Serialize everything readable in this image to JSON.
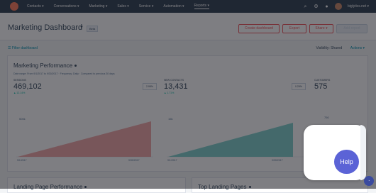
{
  "nav": {
    "items": [
      "Contacts ▾",
      "Conversations ▾",
      "Marketing ▾",
      "Sales ▾",
      "Service ▾",
      "Automation ▾",
      "Reports ▾"
    ],
    "account": "biglytics.net ▾"
  },
  "header": {
    "title": "Marketing Dashboard",
    "beta": "Beta",
    "create_button": "Create dashboard",
    "export_button": "Export",
    "share_button": "Share ▾",
    "add_report_button": "Add report"
  },
  "filters": {
    "left": "☰  Filter dashboard",
    "visibility": "Visibility:  Shared",
    "actions": "Actions ▾"
  },
  "performance": {
    "title": "Marketing Performance",
    "meta": "Date range: From 9/1/2017 to 9/30/2017  ·  Frequency: Daily  ·  Compared to previous 30 days",
    "kpis": [
      {
        "label": "SESSIONS",
        "value": "469,102",
        "delta": "▲ 12.14%",
        "pill": "2.95%"
      },
      {
        "label": "NEW CONTACTS",
        "value": "13,431",
        "delta": "▲ 1.71%",
        "pill": "0.29%"
      },
      {
        "label": "CUSTOMERS",
        "value": "575"
      }
    ],
    "charts": [
      {
        "ymax_label": "500k",
        "x_start": "9/1/2017",
        "x_end": "9/30/2017",
        "color": "#f2a6a6"
      },
      {
        "ymax_label": "15k",
        "x_start": "9/1/2017",
        "x_end": "9/30/2017",
        "color": "#7fd1cc"
      },
      {
        "ymax_label": "750"
      }
    ]
  },
  "bottom": {
    "landing_perf": "Landing Page Performance",
    "top_pages": "Top Landing Pages"
  },
  "help": {
    "label": "Help"
  }
}
